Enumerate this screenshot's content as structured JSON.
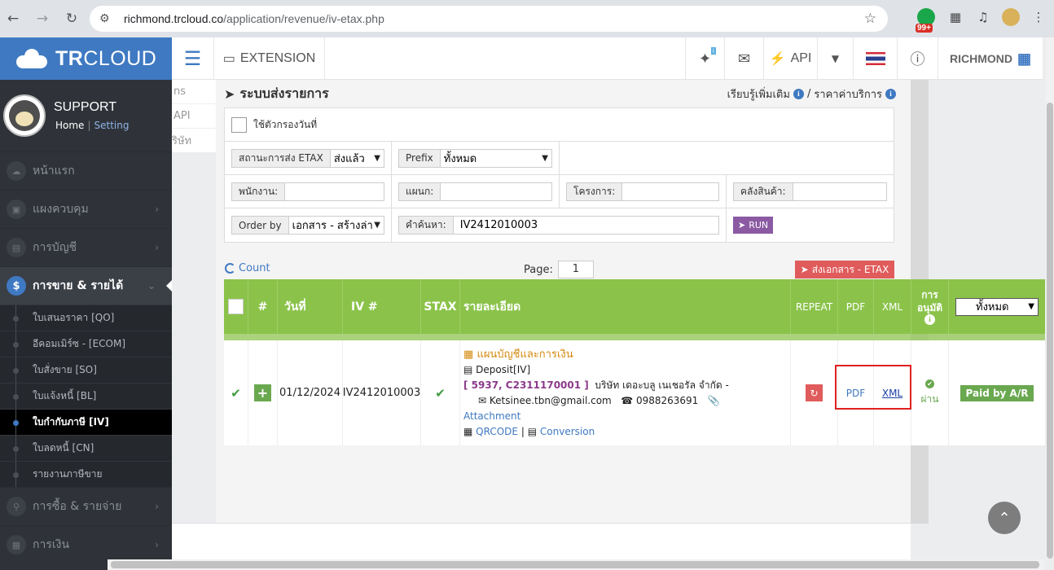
{
  "browser": {
    "url_host": "richmond.trcloud.co",
    "url_path": "/application/revenue/iv-etax.php",
    "badge": "99+"
  },
  "sidebar": {
    "logo_bold": "TR",
    "logo_rest": "CLOUD",
    "user_name": "SUPPORT",
    "home": "Home",
    "setting": "Setting",
    "items": [
      {
        "label": "หน้าแรก",
        "icon": "cloud-icon"
      },
      {
        "label": "แผงควบคุม",
        "icon": "monitor-icon"
      },
      {
        "label": "การบัญชี",
        "icon": "book-icon"
      },
      {
        "label": "การขาย & รายได้",
        "icon": "dollar-icon"
      },
      {
        "label": "การซื้อ & รายจ่าย",
        "icon": "cart-icon"
      },
      {
        "label": "การเงิน",
        "icon": "calculator-icon"
      }
    ],
    "sub_items": [
      "ใบเสนอราคา [QO]",
      "อีคอมเมิร์ซ - [ECOM]",
      "ใบสั่งขาย [SO]",
      "ใบแจ้งหนี้ [BL]",
      "ใบกำกับภาษี [IV]",
      "ใบลดหนี้ [CN]",
      "รายงานภาษีขาย"
    ]
  },
  "topnav": {
    "extension": "EXTENSION",
    "api": "API",
    "company": "RICHMOND",
    "mini_badge": "i"
  },
  "behind_tabs": [
    "ns",
    "API",
    "ริษัท"
  ],
  "page": {
    "title": "ระบบส่งรายการ",
    "learn_more": "เรียบรู้เพิ่มเติม",
    "slash": "/",
    "pricing": "ราคาค่าบริการ"
  },
  "filters": {
    "date_filter_label": "ใช้ตัวกรองวันที่",
    "etax_status_label": "สถานะการส่ง ETAX",
    "etax_status_value": "ส่งแล้ว",
    "prefix_label": "Prefix",
    "prefix_value": "ทั้งหมด",
    "employee_label": "พนักงาน:",
    "department_label": "แผนก:",
    "project_label": "โครงการ:",
    "warehouse_label": "คลังสินค้า:",
    "order_by_label": "Order by",
    "order_by_value": "เอกสาร - สร้างล่า",
    "search_label": "คำค้นหา:",
    "search_value": "IV2412010003",
    "run": "RUN"
  },
  "toolbar": {
    "count": "Count",
    "page_label": "Page:",
    "page_value": "1",
    "send_etax": "ส่งเอกสาร - ETAX"
  },
  "table": {
    "headers": {
      "num": "#",
      "date": "วันที่",
      "iv": "IV #",
      "stax": "STAX",
      "detail": "รายละเอียด",
      "repeat": "REPEAT",
      "pdf": "PDF",
      "xml": "XML",
      "approve_1": "การ",
      "approve_2": "อนุมัติ",
      "filter_value": "ทั้งหมด"
    },
    "row": {
      "date": "01/12/2024",
      "iv": "IV2412010003",
      "department": "แผนบัญชีและการเงิน",
      "deposit": "Deposit[IV]",
      "code": "[ 5937, C2311170001 ]",
      "company": "บริษัท เดอะบลู เนเชอรัล จำกัด -",
      "email": "Ketsinee.tbn@gmail.com",
      "phone": "0988263691",
      "attachment": "Attachment",
      "qrcode": "QRCODE",
      "sep": "|",
      "conversion": "Conversion",
      "pdf": "PDF",
      "xml": "XML",
      "approved": "ผ่าน",
      "status": "Paid by A/R"
    }
  }
}
